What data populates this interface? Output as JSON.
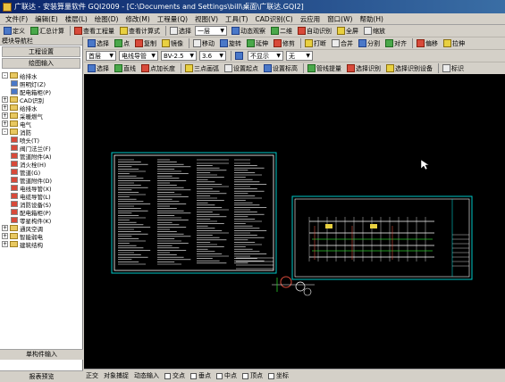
{
  "window": {
    "title": "广联达 - 安装算量软件 GQI2009 - [C:\\Documents and Settings\\bill\\桌面\\广联达.GQI2]"
  },
  "menu": [
    "文件(F)",
    "编辑(E)",
    "楼层(L)",
    "绘图(D)",
    "修改(M)",
    "工程量(Q)",
    "视图(V)",
    "工具(T)",
    "CAD识别(C)",
    "云应用",
    "窗口(W)",
    "帮助(H)"
  ],
  "toolbar1": {
    "items": [
      "定义",
      "汇总计算",
      "查看工程量",
      "查看计算式",
      "选择",
      "动态观察",
      "二维",
      "自动识别",
      "全屏",
      "缩放"
    ],
    "dropdown": "一层"
  },
  "toolbar2": {
    "items": [
      "选择",
      "点",
      "复制",
      "镜像",
      "移动",
      "旋转",
      "延伸",
      "修剪",
      "打断",
      "合并",
      "分割",
      "对齐",
      "偏移",
      "拉伸"
    ]
  },
  "toolbar3": {
    "floor": "首层",
    "category": "电线导管",
    "component": "BV-2.5",
    "floor_height": "3.6",
    "selected": "不显示",
    "layer": "无"
  },
  "toolbar4": {
    "items": [
      "选择",
      "直线",
      "点加长度",
      "三点画弧",
      "设置起点",
      "设置标高",
      "管线提量",
      "选择识别",
      "选择识别设备",
      "标识"
    ]
  },
  "leftpanel": {
    "header": "模块导航栏",
    "btn1": "工程设置",
    "btn2": "绘图输入",
    "tree": [
      {
        "level": 0,
        "exp": "-",
        "label": "给排水",
        "type": "folder"
      },
      {
        "level": 1,
        "exp": "",
        "label": "照明灯(Z)",
        "type": "leaf",
        "color": "#4a78c8"
      },
      {
        "level": 1,
        "exp": "",
        "label": "配电箱柜(P)",
        "type": "leaf",
        "color": "#4a78c8"
      },
      {
        "level": 0,
        "exp": "+",
        "label": "CAD识别",
        "type": "folder"
      },
      {
        "level": 0,
        "exp": "+",
        "label": "给排水",
        "type": "folder"
      },
      {
        "level": 0,
        "exp": "+",
        "label": "采暖燃气",
        "type": "folder"
      },
      {
        "level": 0,
        "exp": "+",
        "label": "电气",
        "type": "folder"
      },
      {
        "level": 0,
        "exp": "-",
        "label": "消防",
        "type": "folder"
      },
      {
        "level": 1,
        "exp": "",
        "label": "喷头(T)",
        "type": "leaf",
        "color": "#d84a3a"
      },
      {
        "level": 1,
        "exp": "",
        "label": "阀门法兰(F)",
        "type": "leaf",
        "color": "#d84a3a"
      },
      {
        "level": 1,
        "exp": "",
        "label": "管道附件(A)",
        "type": "leaf",
        "color": "#d84a3a"
      },
      {
        "level": 1,
        "exp": "",
        "label": "消火栓(H)",
        "type": "leaf",
        "color": "#d84a3a"
      },
      {
        "level": 1,
        "exp": "",
        "label": "管道(G)",
        "type": "leaf",
        "color": "#d84a3a"
      },
      {
        "level": 1,
        "exp": "",
        "label": "管道附件(D)",
        "type": "leaf",
        "color": "#d84a3a"
      },
      {
        "level": 1,
        "exp": "",
        "label": "电线导管(X)",
        "type": "leaf",
        "color": "#d84a3a"
      },
      {
        "level": 1,
        "exp": "",
        "label": "电缆导管(L)",
        "type": "leaf",
        "color": "#d84a3a"
      },
      {
        "level": 1,
        "exp": "",
        "label": "消防设备(S)",
        "type": "leaf",
        "color": "#d84a3a"
      },
      {
        "level": 1,
        "exp": "",
        "label": "配电箱柜(P)",
        "type": "leaf",
        "color": "#d84a3a"
      },
      {
        "level": 1,
        "exp": "",
        "label": "零星构件(K)",
        "type": "leaf",
        "color": "#d84a3a"
      },
      {
        "level": 0,
        "exp": "+",
        "label": "通风空调",
        "type": "folder"
      },
      {
        "level": 0,
        "exp": "+",
        "label": "智能弱电",
        "type": "folder"
      },
      {
        "level": 0,
        "exp": "+",
        "label": "建筑结构",
        "type": "folder"
      }
    ],
    "footer1": "单构件输入",
    "footer2": "报表预览"
  },
  "statusbar": {
    "items": [
      "正交",
      "对象捕捉",
      "动态输入",
      "交点",
      "垂点",
      "中点",
      "顶点",
      "坐标"
    ]
  },
  "colors": {
    "canvas_bg": "#000000",
    "drawing_border": "#00c8c8",
    "drawing_text": "#ffffff"
  }
}
